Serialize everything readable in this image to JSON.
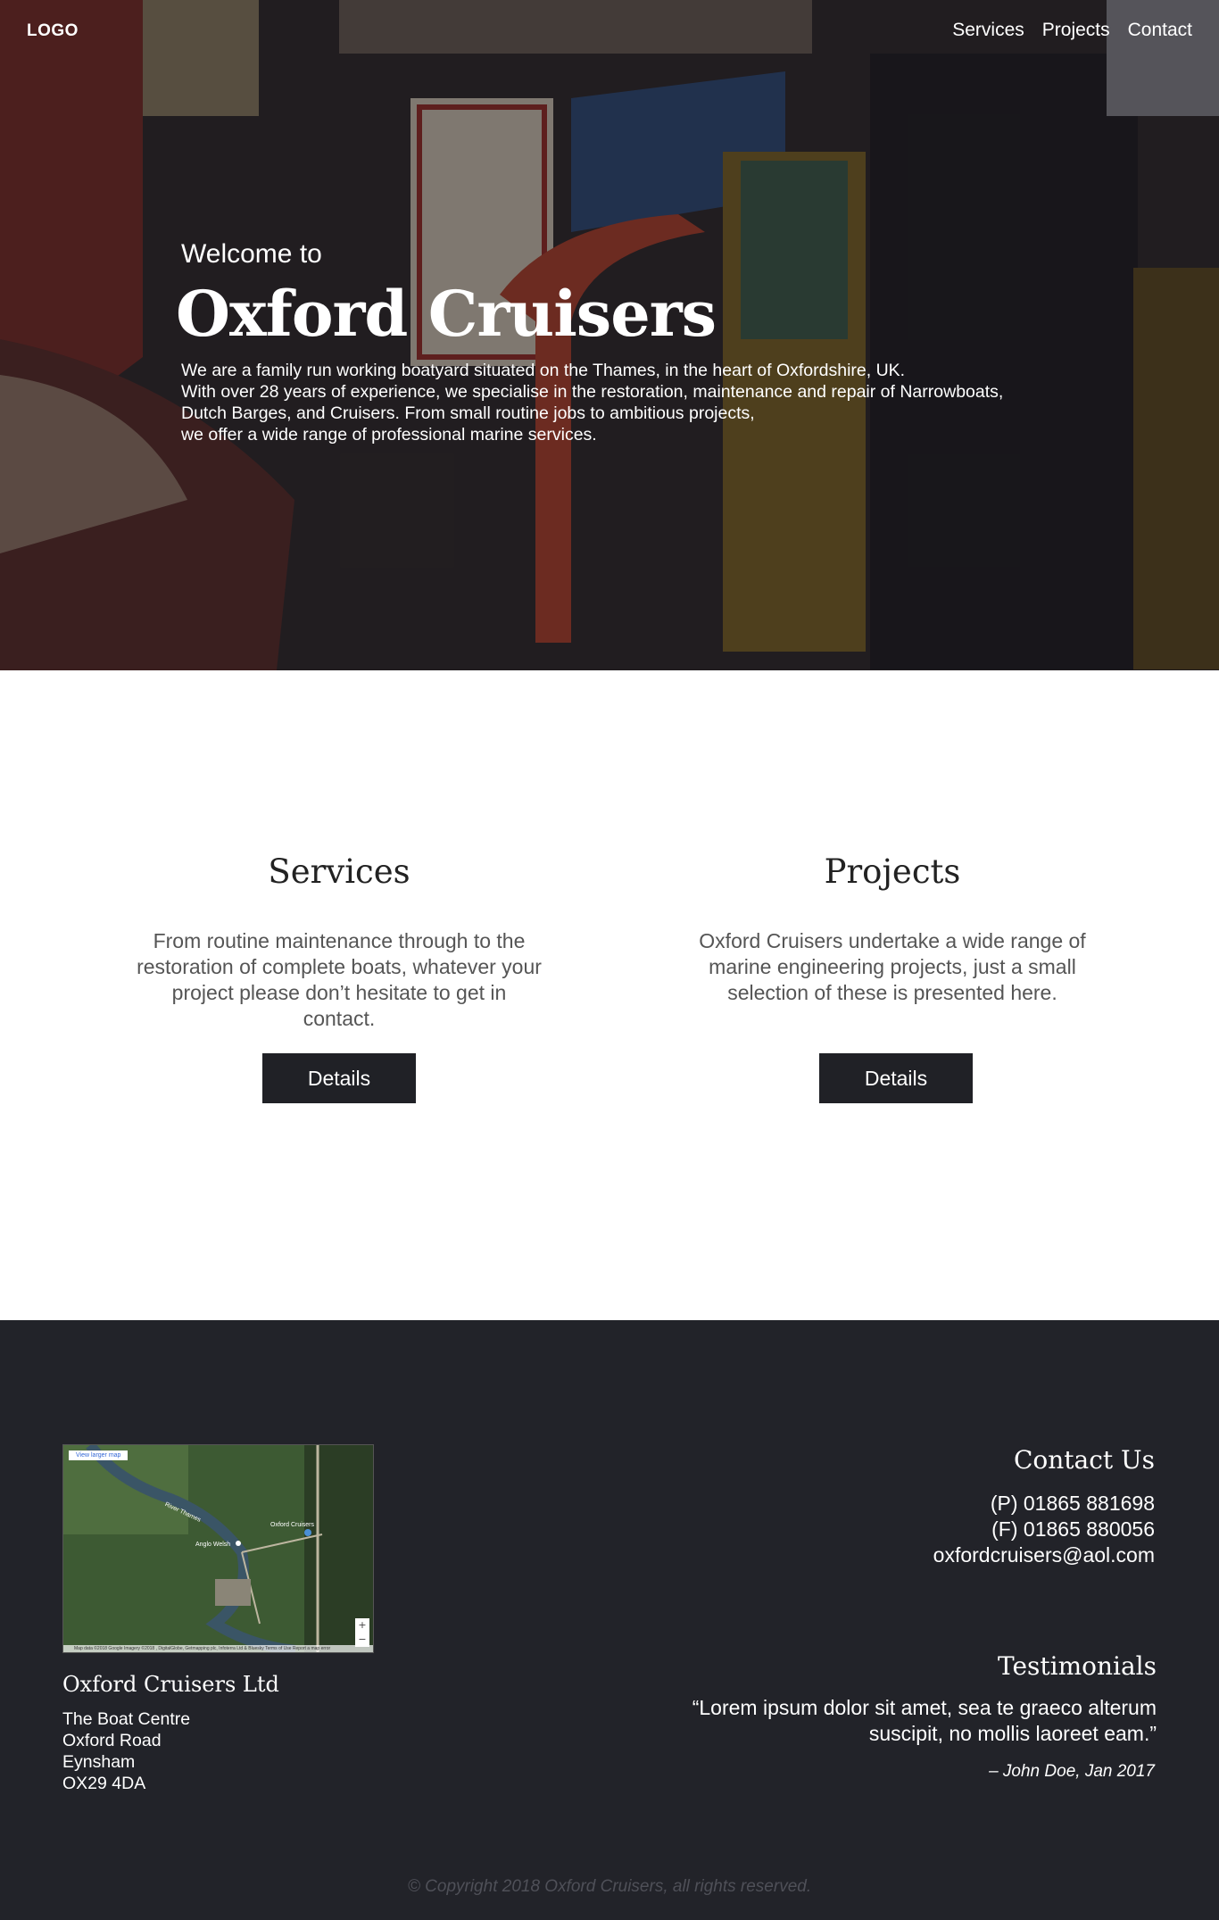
{
  "header": {
    "logo": "LOGO",
    "nav": [
      "Services",
      "Projects",
      "Contact"
    ]
  },
  "hero": {
    "welcome": "Welcome to",
    "title": "Oxford Cruisers",
    "description": [
      "We are a family run working boatyard situated on the Thames, in the heart of Oxfordshire, UK.",
      "With over 28 years of experience, we specialise in the restoration, maintenance and repair of Narrowboats,",
      "Dutch Barges, and Cruisers. From small routine jobs to ambitious projects,",
      "we offer a wide range of professional marine services."
    ]
  },
  "services": {
    "title": "Services",
    "text": "From routine maintenance through to the restoration of complete boats, whatever your project please don’t hesitate to get in contact.",
    "button": "Details"
  },
  "projects": {
    "title": "Projects",
    "text": "Oxford Cruisers undertake a wide range of marine engineering projects, just a small selection of these is presented here.",
    "button": "Details"
  },
  "map": {
    "link": "View larger map",
    "label_marker": "Oxford Cruisers",
    "label_river": "River Thames",
    "label_other": "Anglo Welsh",
    "attribution": "Map data ©2018 Google Imagery ©2018 , DigitalGlobe, Getmapping plc, Infoterra Ltd & Bluesky  Terms of Use  Report a map error"
  },
  "footer": {
    "company": "Oxford Cruisers Ltd",
    "address": [
      "The Boat Centre",
      "Oxford Road",
      "Eynsham",
      "OX29 4DA"
    ],
    "contact": {
      "title": "Contact Us",
      "phone": "(P)  01865 881698",
      "fax": "(F)  01865 880056",
      "email": "oxfordcruisers@aol.com"
    },
    "testimonials": {
      "title": "Testimonials",
      "quote": "“Lorem ipsum dolor sit amet, sea te graeco alterum suscipit, no mollis laoreet eam.”",
      "author": "– John Doe, Jan 2017"
    },
    "copyright": "© Copyright 2018 Oxford Cruisers, all rights reserved."
  },
  "colors": {
    "dark": "#222329",
    "button": "#202126",
    "white": "#ffffff"
  }
}
